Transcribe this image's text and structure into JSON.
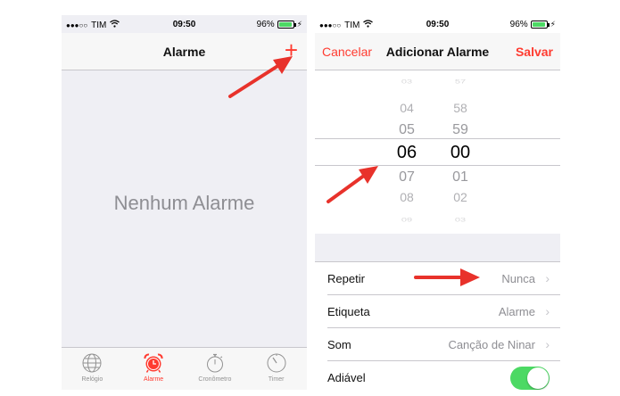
{
  "status_bar": {
    "signal_dots": "●●●○○",
    "carrier": "TIM",
    "wifi_icon": "wifi-icon",
    "time": "09:50",
    "battery": "96%",
    "battery_level": 0.96
  },
  "left_screen": {
    "title": "Alarme",
    "add_label": "+",
    "empty_text": "Nenhum Alarme",
    "tabs": [
      {
        "label": "Relógio",
        "icon": "globe-icon",
        "active": false
      },
      {
        "label": "Alarme",
        "icon": "alarm-clock-icon",
        "active": true
      },
      {
        "label": "Cronômetro",
        "icon": "stopwatch-icon",
        "active": false
      },
      {
        "label": "Timer",
        "icon": "timer-icon",
        "active": false
      }
    ]
  },
  "right_screen": {
    "cancel_label": "Cancelar",
    "title": "Adicionar Alarme",
    "save_label": "Salvar",
    "picker": {
      "hours": [
        "03",
        "04",
        "05",
        "06",
        "07",
        "08",
        "09"
      ],
      "minutes": [
        "57",
        "58",
        "59",
        "00",
        "01",
        "02",
        "03"
      ],
      "selected_hour": "06",
      "selected_minute": "00"
    },
    "rows": [
      {
        "label": "Repetir",
        "value": "Nunca"
      },
      {
        "label": "Etiqueta",
        "value": "Alarme"
      },
      {
        "label": "Som",
        "value": "Canção de Ninar"
      },
      {
        "label": "Adiável",
        "toggle": true
      }
    ],
    "chevron": "›"
  },
  "colors": {
    "accent": "#ff3b30",
    "toggle_on": "#4cd964",
    "arrow": "#e8322b"
  }
}
